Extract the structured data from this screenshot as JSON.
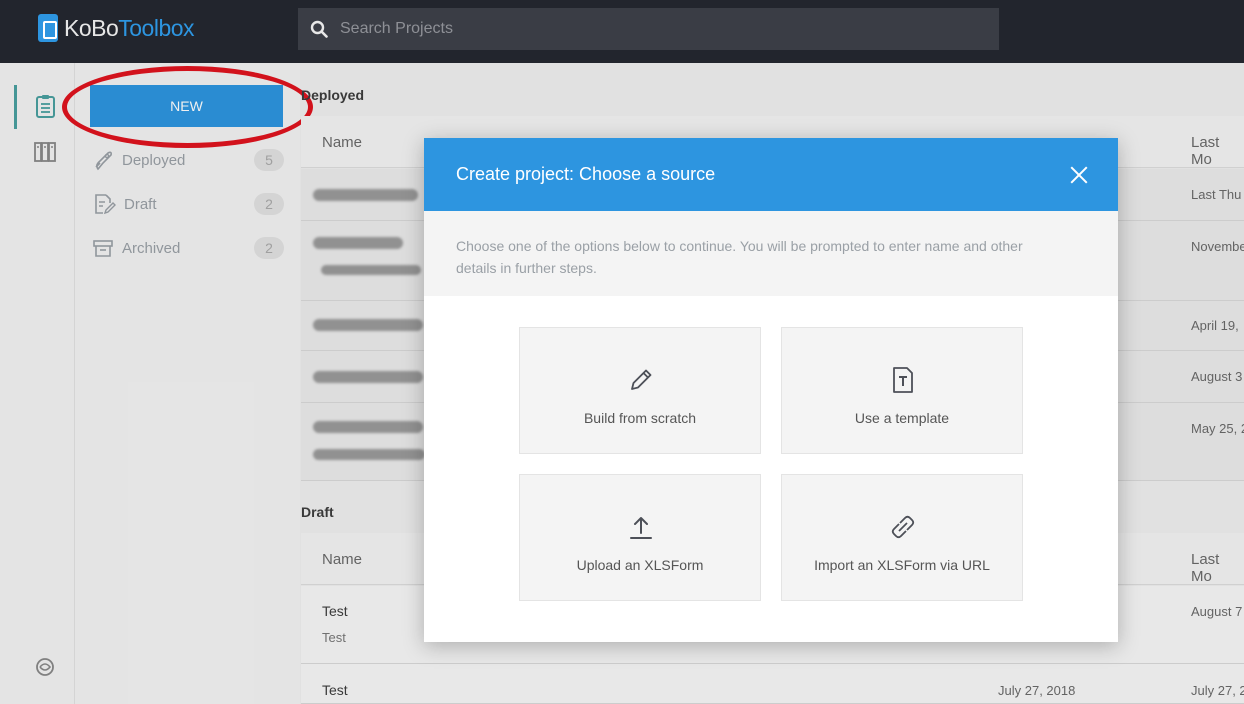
{
  "app": {
    "logo_part1": "KoBo",
    "logo_part2": "Toolbox"
  },
  "search": {
    "placeholder": "Search Projects"
  },
  "sidebar": {
    "new_label": "NEW",
    "items": [
      {
        "label": "Deployed",
        "count": "5",
        "icon": "rocket-icon"
      },
      {
        "label": "Draft",
        "count": "2",
        "icon": "draft-icon"
      },
      {
        "label": "Archived",
        "count": "2",
        "icon": "archive-icon"
      }
    ]
  },
  "deployed": {
    "title": "Deployed",
    "col_name": "Name",
    "col_modified": "Last Mo",
    "rows": [
      {
        "date": "Last Thu"
      },
      {
        "date": "Novembe"
      },
      {
        "date": "April 19,"
      },
      {
        "date": "August 3"
      },
      {
        "date": "May 25, 2"
      }
    ]
  },
  "draft": {
    "title": "Draft",
    "col_name": "Name",
    "col_modified": "Last Mo",
    "rows": [
      {
        "name": "Test",
        "sub": "Test",
        "date": "August 7"
      },
      {
        "name": "Test",
        "sub": "",
        "date_created": "July 27, 2018",
        "date": "July 27, 2"
      }
    ]
  },
  "modal": {
    "title": "Create project: Choose a source",
    "description": "Choose one of the options below to continue. You will be prompted to enter name and other details in further steps.",
    "options": [
      {
        "label": "Build from scratch",
        "icon": "pencil-icon"
      },
      {
        "label": "Use a template",
        "icon": "template-icon"
      },
      {
        "label": "Upload an XLSForm",
        "icon": "upload-icon"
      },
      {
        "label": "Import an XLSForm via URL",
        "icon": "link-icon"
      }
    ]
  },
  "colors": {
    "accent": "#2d95e0",
    "topbar": "#22252d",
    "highlight": "#e0141e"
  }
}
